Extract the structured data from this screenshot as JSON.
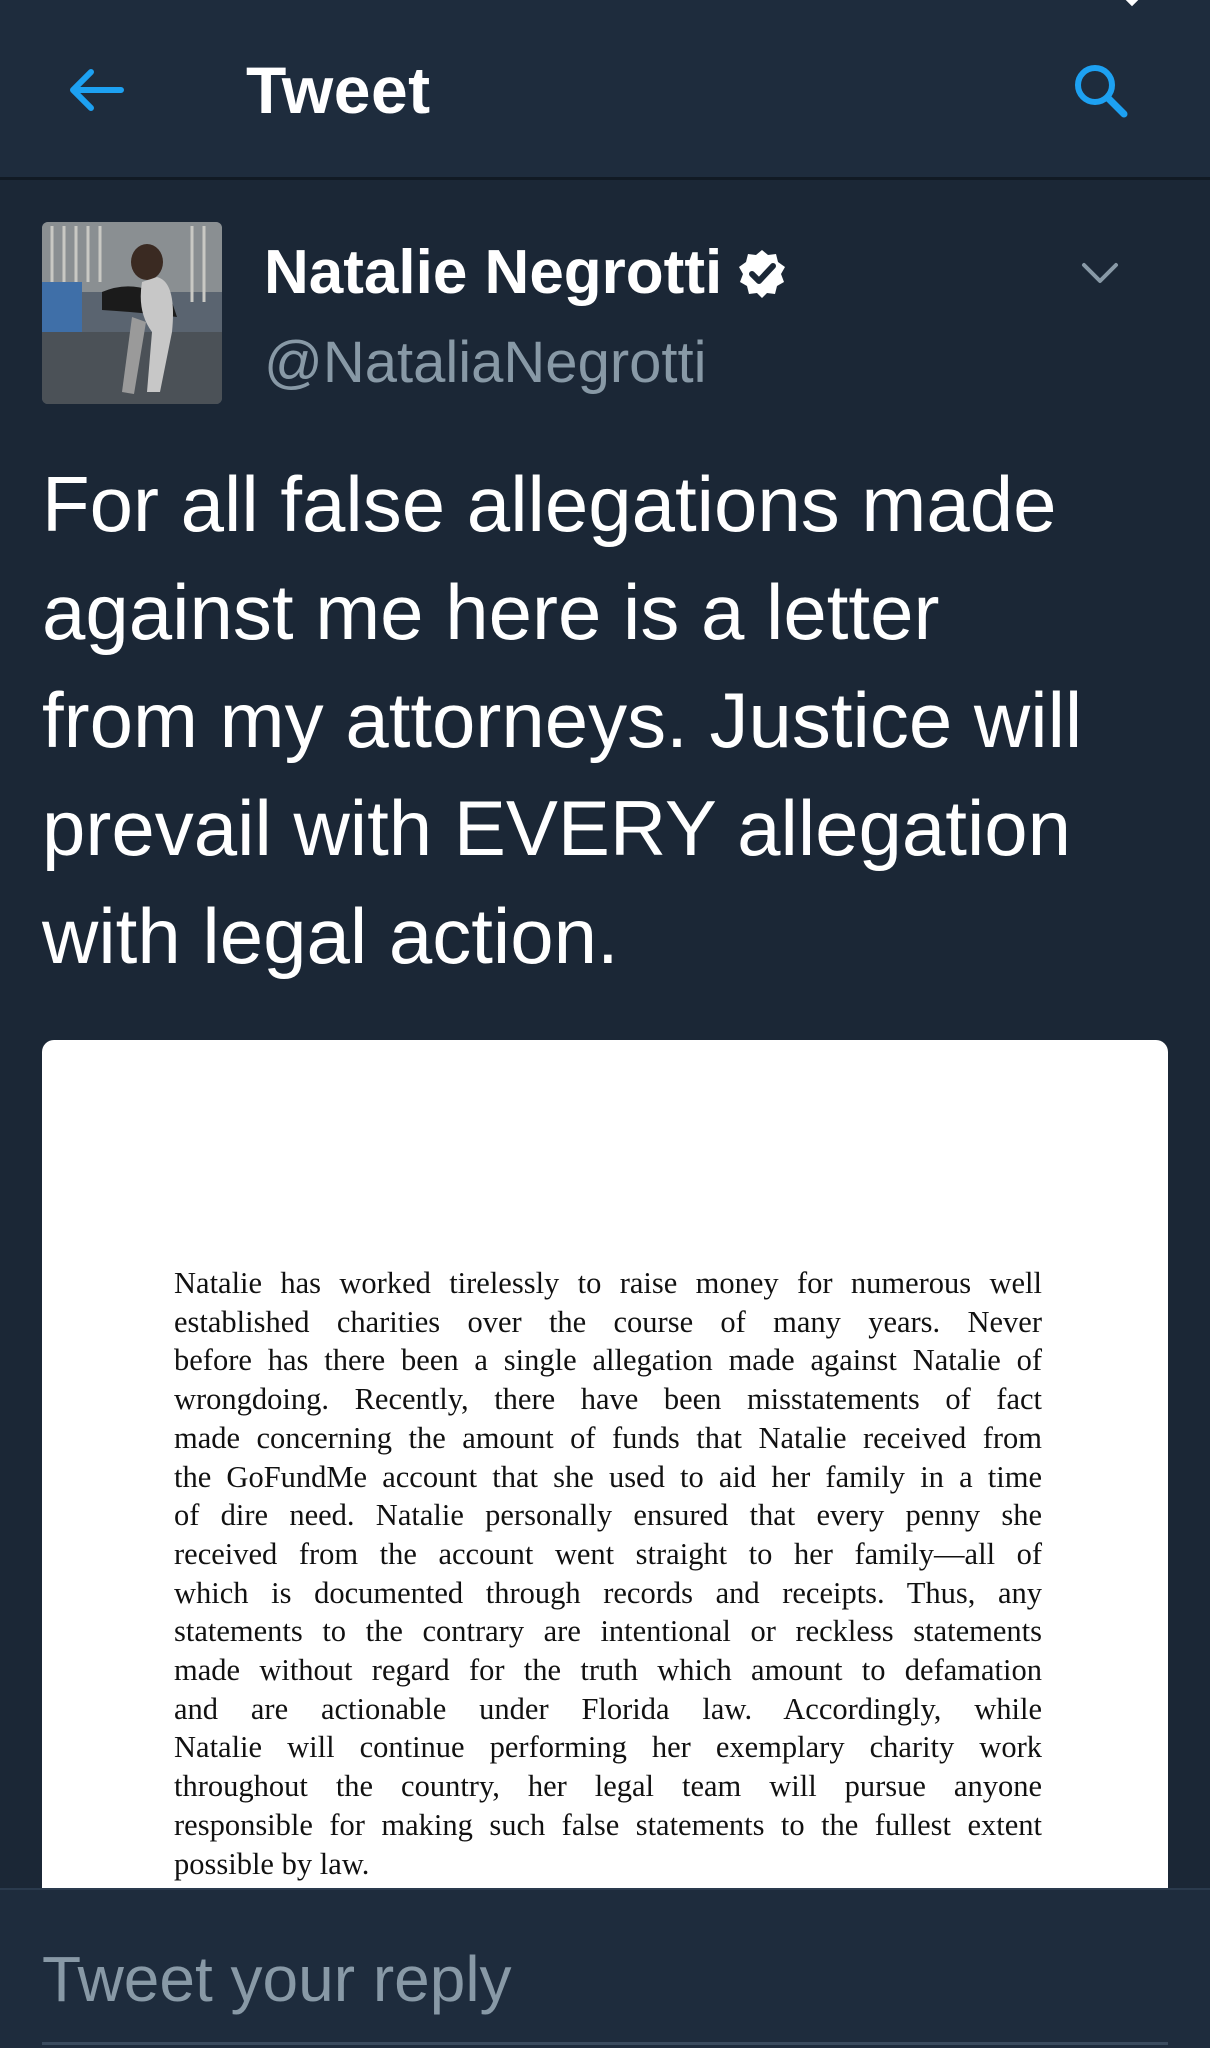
{
  "header": {
    "title": "Tweet",
    "back_icon": "arrow-left-icon",
    "search_icon": "search-icon",
    "accent_color": "#1da1f2"
  },
  "author": {
    "name": "Natalie Negrotti",
    "handle": "@NataliaNegrotti",
    "verified": true
  },
  "tweet": {
    "text_lines": [
      "For all false allegations made",
      "against me here is a letter",
      "from my attorneys. Justice will",
      "prevail with EVERY allegation",
      "with legal action."
    ]
  },
  "media": {
    "letter_lines": [
      "Natalie has worked tirelessly to raise money for numerous well",
      "established charities over the course of many years.  Never",
      "before has there been a single allegation made against Natalie of",
      "wrongdoing.  Recently, there have been misstatements of fact",
      "made concerning the amount of funds that Natalie received from",
      "the GoFundMe account that she used to aid her family in a time",
      "of dire need.  Natalie personally ensured that every penny she",
      "received from the account went straight to her family—all of",
      "which is documented through records and receipts.  Thus, any",
      "statements to the contrary are intentional or reckless statements",
      "made without regard for the truth which amount to defamation",
      "and are actionable under Florida law.  Accordingly, while",
      "Natalie will continue performing her exemplary charity work",
      "throughout the country, her legal team will pursue anyone",
      "responsible for making such false statements to the fullest extent",
      "possible by law."
    ]
  },
  "reply": {
    "placeholder": "Tweet your reply"
  }
}
